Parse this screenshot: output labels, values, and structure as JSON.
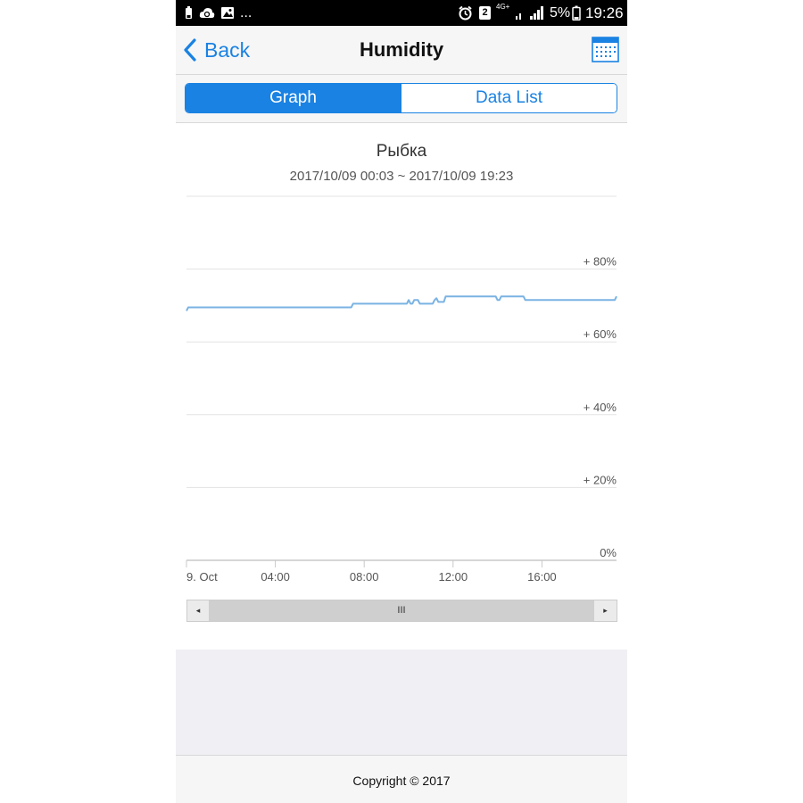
{
  "status_bar": {
    "left_icons": [
      "battery-low-icon",
      "cloud-sync-icon",
      "gallery-icon"
    ],
    "more": "...",
    "sim_badge": "2",
    "network": "4G+",
    "battery_percent": "5%",
    "time": "19:26"
  },
  "nav": {
    "back_label": "Back",
    "title": "Humidity",
    "calendar_icon": "calendar-icon"
  },
  "tabs": [
    {
      "label": "Graph",
      "active": true
    },
    {
      "label": "Data List",
      "active": false
    }
  ],
  "chart": {
    "title": "Рыбка",
    "subtitle": "2017/10/09 00:03 ~ 2017/10/09 19:23"
  },
  "chart_data": {
    "type": "line",
    "title": "Рыбка",
    "subtitle": "2017/10/09 00:03 ~ 2017/10/09 19:23",
    "xlabel": "",
    "ylabel": "",
    "ylim": [
      0,
      100
    ],
    "y_ticks": [
      "0%",
      "+ 20%",
      "+ 40%",
      "+ 60%",
      "+ 80%"
    ],
    "x_ticks": [
      "9. Oct",
      "04:00",
      "08:00",
      "12:00",
      "16:00"
    ],
    "grid": true,
    "line_color": "#7ab3e3",
    "series": [
      {
        "x": [
          "00:03",
          "01:00",
          "02:00",
          "03:00",
          "04:00",
          "05:00",
          "06:00",
          "07:00",
          "07:20",
          "07:30",
          "08:00",
          "09:00",
          "09:45",
          "10:00",
          "10:05",
          "10:15",
          "10:30",
          "11:00",
          "11:10",
          "11:15",
          "11:20",
          "11:35",
          "11:40",
          "12:00",
          "12:30",
          "13:00",
          "13:45",
          "14:00",
          "14:10",
          "14:30",
          "15:00",
          "15:15",
          "15:30",
          "16:00",
          "17:00",
          "18:00",
          "19:00",
          "19:15",
          "19:23"
        ],
        "y": [
          69.5,
          69.5,
          69.5,
          69.5,
          69.5,
          69.5,
          69.5,
          69.5,
          69.5,
          70.5,
          70.5,
          70.5,
          70.5,
          71.5,
          70.5,
          71.5,
          70.5,
          70.5,
          71.5,
          72,
          71,
          71,
          72.5,
          72.5,
          72.5,
          72.5,
          72.5,
          71.5,
          72.5,
          72.5,
          72.5,
          71.5,
          71.5,
          71.5,
          71.5,
          71.5,
          71.5,
          71.5,
          72.5
        ]
      }
    ]
  },
  "scrollbar": {
    "left_arrow": "◂",
    "thumb_grip": "III",
    "right_arrow": "▸"
  },
  "footer": {
    "copyright": "Copyright © 2017"
  }
}
